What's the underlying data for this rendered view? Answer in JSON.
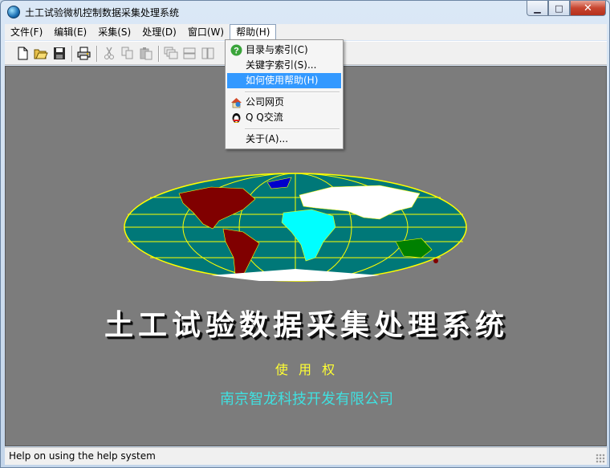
{
  "window": {
    "title": "土工试验微机控制数据采集处理系统",
    "caption_minimize": "▁",
    "caption_maximize": "□",
    "caption_close": "✕"
  },
  "menubar": {
    "items": [
      {
        "label": "文件(F)"
      },
      {
        "label": "编辑(E)"
      },
      {
        "label": "采集(S)"
      },
      {
        "label": "处理(D)"
      },
      {
        "label": "窗口(W)"
      },
      {
        "label": "帮助(H)"
      }
    ]
  },
  "toolbar": {
    "icons": [
      "new-file-icon",
      "open-folder-icon",
      "save-disk-icon",
      "print-icon",
      "cut-icon",
      "copy-icon",
      "paste-icon",
      "cascade-icon",
      "tile-horizontal-icon",
      "tile-vertical-icon"
    ]
  },
  "help_menu": {
    "items": [
      {
        "label": "目录与索引(C)",
        "icon": "help-question-icon"
      },
      {
        "label": "关键字索引(S)...",
        "icon": ""
      },
      {
        "label": "如何使用帮助(H)",
        "icon": "",
        "highlighted": true
      },
      {
        "label": "公司网页",
        "icon": "home-web-icon"
      },
      {
        "label": "Q Q交流",
        "icon": "qq-penguin-icon"
      },
      {
        "label": "关于(A)...",
        "icon": ""
      }
    ]
  },
  "splash": {
    "heading": "土工试验数据采集处理系统",
    "rights": "使 用 权",
    "company": "南京智龙科技开发有限公司"
  },
  "status": {
    "text": "Help on using the help system"
  },
  "colors": {
    "client_bg": "#7c7c7c",
    "ocean": "#007878",
    "graticule": "#ffff00",
    "highlight": "#3399ff"
  }
}
